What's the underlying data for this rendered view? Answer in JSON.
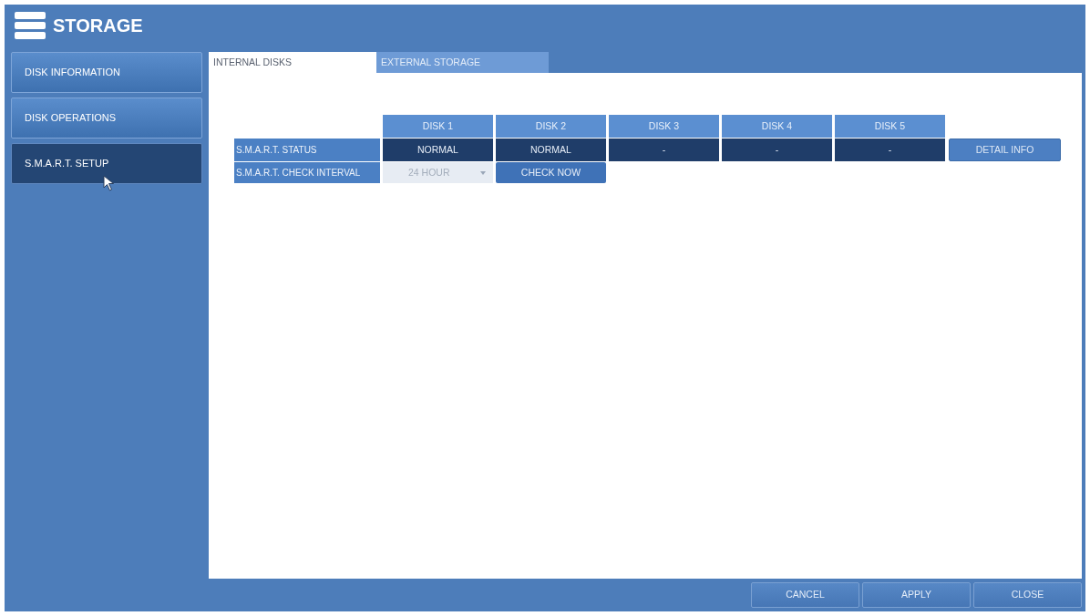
{
  "window": {
    "title": "STORAGE"
  },
  "sidebar": {
    "items": [
      {
        "label": "DISK INFORMATION",
        "selected": false
      },
      {
        "label": "DISK OPERATIONS",
        "selected": false
      },
      {
        "label": "S.M.A.R.T. SETUP",
        "selected": true
      }
    ]
  },
  "tabs": [
    {
      "label": "INTERNAL DISKS",
      "selected": true
    },
    {
      "label": "EXTERNAL STORAGE",
      "selected": false
    }
  ],
  "table": {
    "columns": [
      "DISK 1",
      "DISK 2",
      "DISK 3",
      "DISK 4",
      "DISK 5"
    ],
    "rows": [
      {
        "kind": "status",
        "label": "S.M.A.R.T. STATUS",
        "cells": [
          "NORMAL",
          "NORMAL",
          "-",
          "-",
          "-"
        ],
        "button": "DETAIL INFO"
      },
      {
        "kind": "interval",
        "label": "S.M.A.R.T. CHECK INTERVAL",
        "dropdown": {
          "value": "24 HOUR",
          "disabled": true
        },
        "button": "CHECK NOW"
      }
    ]
  },
  "buttons": [
    "CANCEL",
    "APPLY",
    "CLOSE"
  ]
}
